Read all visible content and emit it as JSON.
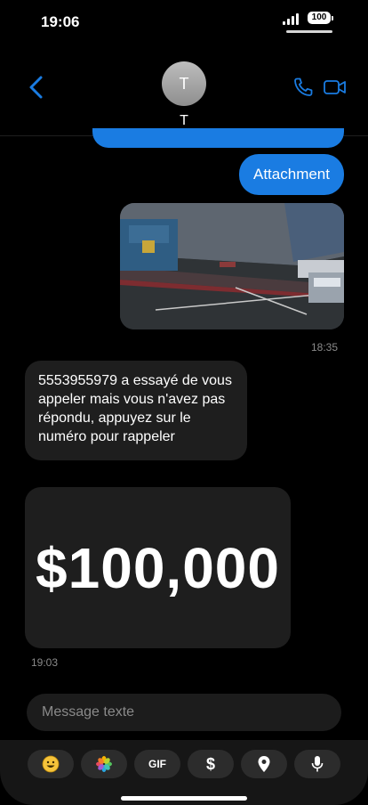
{
  "status": {
    "time": "19:06",
    "battery": "100"
  },
  "contact": {
    "initial": "T",
    "name": "T"
  },
  "messages": {
    "outgoing_text": "Attachment",
    "outgoing_time": "18:35",
    "incoming_text": "5553955979 a essayé de vous appeler mais vous n'avez pas répondu, appuyez sur le numéro pour rappeler",
    "money_amount": "$100,000",
    "incoming_time": "19:03"
  },
  "composer": {
    "placeholder": "Message texte"
  },
  "toolbar": {
    "gif_label": "GIF",
    "money_label": "$",
    "items": [
      "emoji-icon",
      "photos-icon",
      "gif-button",
      "money-icon",
      "location-pin-icon",
      "microphone-icon"
    ]
  },
  "colors": {
    "accent": "#1a7ce2",
    "incoming_bubble": "#1e1e1e",
    "background": "#000000"
  }
}
